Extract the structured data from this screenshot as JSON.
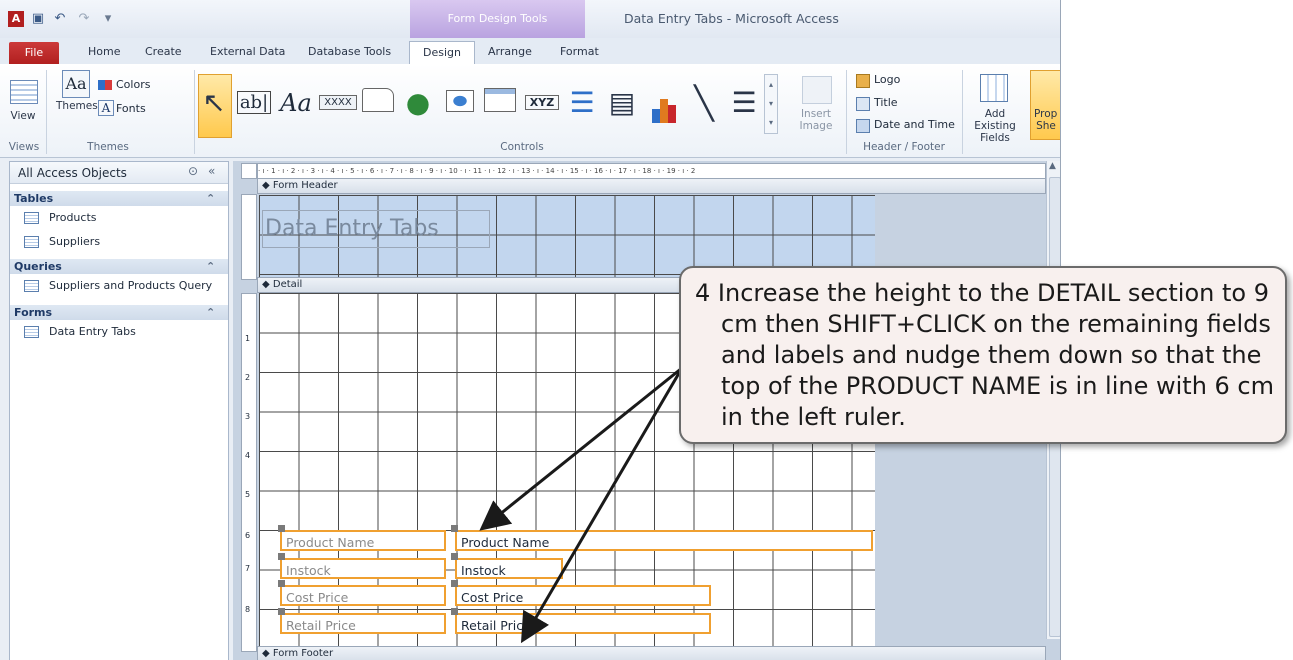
{
  "window": {
    "title": "Data Entry Tabs - Microsoft Access",
    "context_tab": "Form Design Tools"
  },
  "tabs": [
    "File",
    "Home",
    "Create",
    "External Data",
    "Database Tools",
    "Design",
    "Arrange",
    "Format"
  ],
  "ribbon": {
    "views": {
      "label": "View",
      "group": "Views"
    },
    "themes": {
      "themes_label": "Themes",
      "colors_label": "Colors",
      "fonts_label": "Fonts",
      "group": "Themes"
    },
    "controls": {
      "group": "Controls",
      "insert_image_label": "Insert Image"
    },
    "header_footer": {
      "logo": "Logo",
      "title": "Title",
      "date_time": "Date and Time",
      "group": "Header / Footer"
    },
    "tools": {
      "add_existing_fields": "Add Existing Fields",
      "property_sheet": "Prope She"
    }
  },
  "nav": {
    "header": "All Access Objects",
    "categories": [
      {
        "name": "Tables",
        "items": [
          "Products",
          "Suppliers"
        ]
      },
      {
        "name": "Queries",
        "items": [
          "Suppliers and Products Query"
        ]
      },
      {
        "name": "Forms",
        "items": [
          "Data Entry Tabs"
        ]
      }
    ]
  },
  "form": {
    "header_section": "Form Header",
    "detail_section": "Detail",
    "footer_section": "Form Footer",
    "title_label": "Data Entry Tabs",
    "ruler_h": "· ı · 1 · ı · 2 · ı · 3 · ı · 4 · ı · 5 · ı · 6 · ı · 7 · ı · 8 · ı · 9 · ı · 10 · ı · 11 · ı · 12 · ı · 13 · ı · 14 · ı · 15 · ı · 16 · ı · 17 · ı · 18 · ı · 19 · ı · 2",
    "ruler_v": [
      "1",
      "2",
      "3",
      "4",
      "5",
      "6",
      "7",
      "8"
    ],
    "fields": [
      {
        "label": "Product Name",
        "control": "Product Name"
      },
      {
        "label": "Instock",
        "control": "Instock"
      },
      {
        "label": "Cost Price",
        "control": "Cost Price"
      },
      {
        "label": "Retail Price",
        "control": "Retail Price"
      }
    ]
  },
  "callout": {
    "text": "4 Increase the height to the DETAIL section to 9 cm then SHIFT+CLICK on the remaining fields and labels and nudge them down so that the top of the PRODUCT NAME is in line with 6 cm in the left ruler."
  },
  "colors": {
    "accent": "#f0a030",
    "file_tab": "#b11f1f",
    "context": "#b9a3e0",
    "header_grid": "#c2d6ee"
  }
}
